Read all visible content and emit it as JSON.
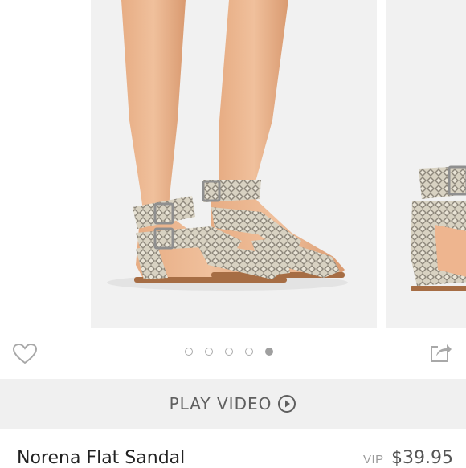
{
  "gallery": {
    "dots": [
      {
        "active": false
      },
      {
        "active": false
      },
      {
        "active": false
      },
      {
        "active": false
      },
      {
        "active": true
      }
    ]
  },
  "video": {
    "label": "PLAY VIDEO"
  },
  "product": {
    "title": "Norena Flat Sandal",
    "vip_label": "VIP",
    "price": "$39.95"
  },
  "icons": {
    "favorite": "heart-icon",
    "share": "share-icon",
    "play": "play-circle-icon"
  },
  "colors": {
    "icon_gray": "#a8a8a8",
    "bar_bg": "#f0f0f0",
    "dot_active": "#9f9f9f"
  }
}
